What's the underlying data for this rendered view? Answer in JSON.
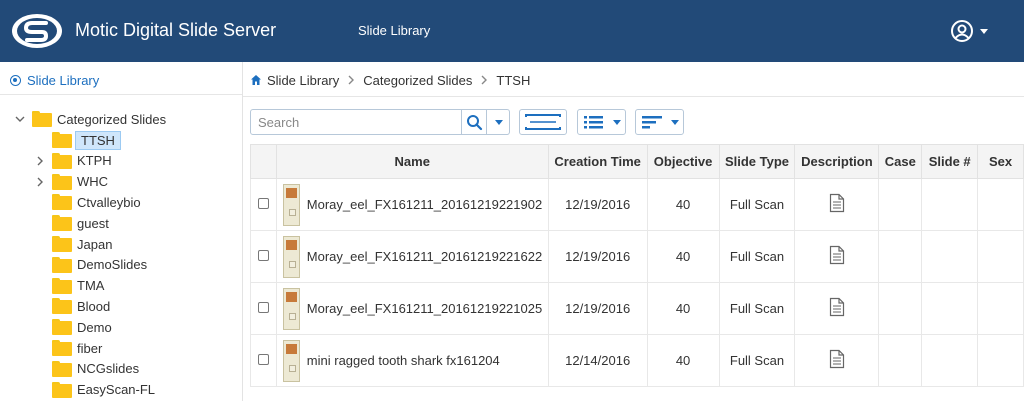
{
  "header": {
    "app_title": "Motic Digital Slide Server",
    "nav_link": "Slide Library",
    "logo_icon": "motic-s-logo",
    "user_icon": "user-circle-icon",
    "colors": {
      "bar": "#224a78",
      "accent": "#1d6fbf",
      "folder": "#fcc419"
    }
  },
  "sidebar": {
    "library_label": "Slide Library",
    "tree": {
      "root_label": "Categorized Slides",
      "children": [
        {
          "label": "TTSH",
          "selected": true,
          "expandable": false
        },
        {
          "label": "KTPH",
          "selected": false,
          "expandable": true
        },
        {
          "label": "WHC",
          "selected": false,
          "expandable": true
        },
        {
          "label": "Ctvalleybio",
          "selected": false,
          "expandable": false
        },
        {
          "label": "guest",
          "selected": false,
          "expandable": false
        },
        {
          "label": "Japan",
          "selected": false,
          "expandable": false
        },
        {
          "label": "DemoSlides",
          "selected": false,
          "expandable": false
        },
        {
          "label": "TMA",
          "selected": false,
          "expandable": false
        },
        {
          "label": "Blood",
          "selected": false,
          "expandable": false
        },
        {
          "label": "Demo",
          "selected": false,
          "expandable": false
        },
        {
          "label": "fiber",
          "selected": false,
          "expandable": false
        },
        {
          "label": "NCGslides",
          "selected": false,
          "expandable": false
        },
        {
          "label": "EasyScan-FL",
          "selected": false,
          "expandable": false
        }
      ]
    }
  },
  "breadcrumb": {
    "items": [
      "Slide Library",
      "Categorized Slides",
      "TTSH"
    ],
    "home_icon": "home-icon",
    "separator_icon": "chevron-right-icon"
  },
  "toolbar": {
    "search_placeholder": "Search",
    "search_icon": "search-icon",
    "dropdown_icon": "caret-down-icon",
    "fit_icon": "fit-width-icon",
    "list_view_icon": "list-view-icon",
    "sort_icon": "sort-icon"
  },
  "table": {
    "columns": [
      "",
      "Name",
      "Creation Time",
      "Objective",
      "Slide Type",
      "Description",
      "Case",
      "Slide #",
      "Sex"
    ],
    "rows": [
      {
        "name": "Moray_eel_FX161211_20161219221902",
        "creation_time": "12/19/2016",
        "objective": "40",
        "slide_type": "Full Scan",
        "description_icon": "document-icon",
        "case": "",
        "slide_no": "",
        "sex": ""
      },
      {
        "name": "Moray_eel_FX161211_20161219221622",
        "creation_time": "12/19/2016",
        "objective": "40",
        "slide_type": "Full Scan",
        "description_icon": "document-icon",
        "case": "",
        "slide_no": "",
        "sex": ""
      },
      {
        "name": "Moray_eel_FX161211_20161219221025",
        "creation_time": "12/19/2016",
        "objective": "40",
        "slide_type": "Full Scan",
        "description_icon": "document-icon",
        "case": "",
        "slide_no": "",
        "sex": ""
      },
      {
        "name": "mini ragged tooth shark fx161204",
        "creation_time": "12/14/2016",
        "objective": "40",
        "slide_type": "Full Scan",
        "description_icon": "document-icon",
        "case": "",
        "slide_no": "",
        "sex": ""
      }
    ]
  }
}
